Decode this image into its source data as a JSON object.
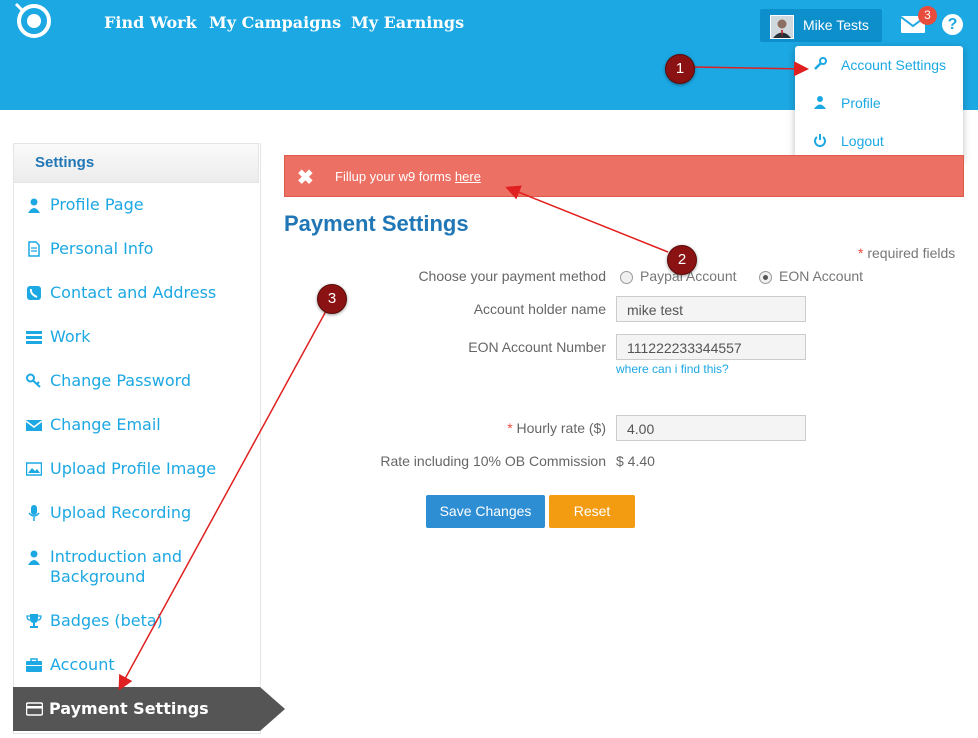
{
  "header": {
    "nav": [
      {
        "label": "Find Work"
      },
      {
        "label": "My Campaigns"
      },
      {
        "label": "My Earnings"
      }
    ],
    "user_name": "Mike Tests",
    "mail_count": "3",
    "help_glyph": "?"
  },
  "dropdown": {
    "items": [
      {
        "label": "Account Settings",
        "icon": "wrench-icon"
      },
      {
        "label": "Profile",
        "icon": "user-icon"
      },
      {
        "label": "Logout",
        "icon": "power-icon"
      }
    ]
  },
  "sidebar": {
    "title": "Settings",
    "items": [
      {
        "label": "Profile Page",
        "icon": "user-icon"
      },
      {
        "label": "Personal Info",
        "icon": "document-icon"
      },
      {
        "label": "Contact and Address",
        "icon": "phone-icon"
      },
      {
        "label": "Work",
        "icon": "list-icon"
      },
      {
        "label": "Change Password",
        "icon": "key-icon"
      },
      {
        "label": "Change Email",
        "icon": "envelope-icon"
      },
      {
        "label": "Upload Profile Image",
        "icon": "image-icon"
      },
      {
        "label": "Upload Recording",
        "icon": "microphone-icon"
      },
      {
        "label": "Introduction and",
        "label2": "Background",
        "icon": "user-icon"
      },
      {
        "label": "Badges (beta)",
        "icon": "trophy-icon"
      },
      {
        "label": "Account",
        "icon": "briefcase-icon"
      },
      {
        "label": "Payment Settings",
        "icon": "credit-card-icon"
      }
    ]
  },
  "alert": {
    "text": "Fillup your w9 forms ",
    "link": "here"
  },
  "form": {
    "title": "Payment Settings",
    "required_star": "*",
    "required_text": " required fields",
    "method_label": "Choose your payment method",
    "paypal_label": "Paypal Account",
    "eon_label": "EON Account",
    "holder_label": "Account holder name",
    "holder_value": "mike test",
    "eon_number_label": "EON Account Number",
    "eon_number_value": "111222233344557",
    "find_link": "where can i find this?",
    "rate_star": "*",
    "rate_label": " Hourly rate ($)",
    "rate_value": "4.00",
    "commission_label": "Rate including 10% OB Commission",
    "commission_value": "$ 4.40",
    "save_label": "Save Changes",
    "reset_label": "Reset"
  },
  "markers": [
    "1",
    "2",
    "3"
  ],
  "colors": {
    "header": "#1ca8e3",
    "title": "#2177b6",
    "alert": "#ec7063",
    "save": "#2e8ed4",
    "reset": "#f39c12",
    "marker": "#8b1212",
    "arrow": "#e02020"
  }
}
